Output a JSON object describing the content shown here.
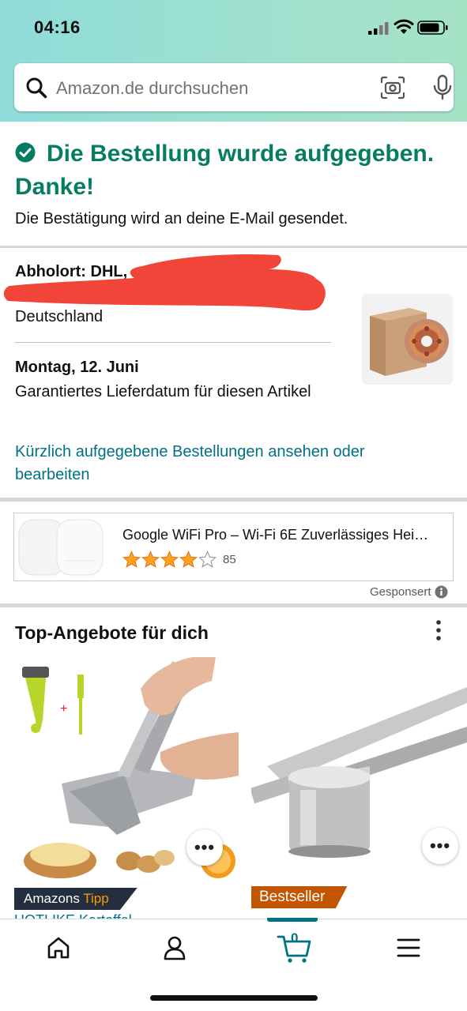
{
  "status_bar": {
    "time": "04:16"
  },
  "search": {
    "placeholder": "Amazon.de durchsuchen"
  },
  "confirmation": {
    "title": "Die Bestellung wurde aufgegeben. Danke!",
    "subtitle": "Die Bestätigung wird an deine E-Mail gesendet."
  },
  "pickup": {
    "label": "Abholort: DHL,",
    "country": "Deutschland",
    "delivery_date": "Montag, 12. Juni",
    "guarantee": "Garantiertes Lieferdatum für diesen Artikel",
    "orders_link": "Kürzlich aufgegebene Bestellungen ansehen oder bearbeiten"
  },
  "sponsored_ad": {
    "title": "Google WiFi Pro – Wi-Fi 6E Zuverlässiges Hei…",
    "rating": 4,
    "rating_max": 5,
    "review_count": "85",
    "sponsored_label": "Gesponsert"
  },
  "deals": {
    "title": "Top-Angebote für dich",
    "items": [
      {
        "badge_prefix": "Amazons ",
        "badge_highlight": "Tipp",
        "cutoff_text": "HOTLIKE Kartoffel"
      },
      {
        "badge": "Bestseller"
      }
    ]
  },
  "bottom_nav": {
    "cart_count": "0"
  },
  "colors": {
    "accent_green": "#067d62",
    "link_teal": "#007185",
    "bestseller_orange": "#c45500",
    "tipp_orange": "#ff9900"
  },
  "icons": [
    "search-icon",
    "camera-icon",
    "mic-icon",
    "check-circle-icon",
    "info-icon",
    "more-vertical-icon",
    "home-icon",
    "account-icon",
    "cart-icon",
    "menu-icon"
  ]
}
